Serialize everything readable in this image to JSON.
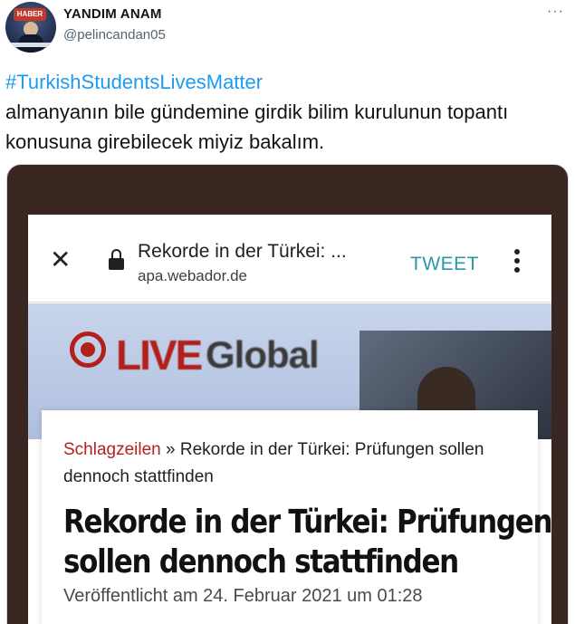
{
  "author": {
    "display_name": "YANDIM ANAM",
    "handle": "@pelincandan05",
    "avatar_logo_text": "HABER"
  },
  "menu": {
    "more_icon": "more-horizontal-icon",
    "more_glyph": "···"
  },
  "tweet": {
    "hashtag": "#TurkishStudentsLivesMatter",
    "body": "almanyanın bile gündemine girdik bilim kurulunun topantı konusuna girebilecek miyiz bakalım."
  },
  "screenshot": {
    "browser": {
      "close_glyph": "✕",
      "page_title": "Rekorde in der Türkei: ...",
      "url": "apa.webador.de",
      "tweet_button": "TWEET"
    },
    "hero": {
      "live_text": "LIVE",
      "global_text": "Global"
    },
    "article": {
      "breadcrumb_link": "Schlagzeilen",
      "breadcrumb_rest": " » Rekorde in der Türkei: Prüfungen sollen dennoch stattfinden",
      "headline_line1": "Rekorde in der Türkei: Prüfungen",
      "headline_line2": "sollen dennoch stattfinden",
      "published": "Veröffentlicht am 24. Februar 2021 um 01:28"
    }
  },
  "colors": {
    "hashtag": "#1d9bf0",
    "tweet_button": "#2a98a8",
    "breadcrumb_link": "#b32020",
    "media_frame": "#3a2620"
  }
}
